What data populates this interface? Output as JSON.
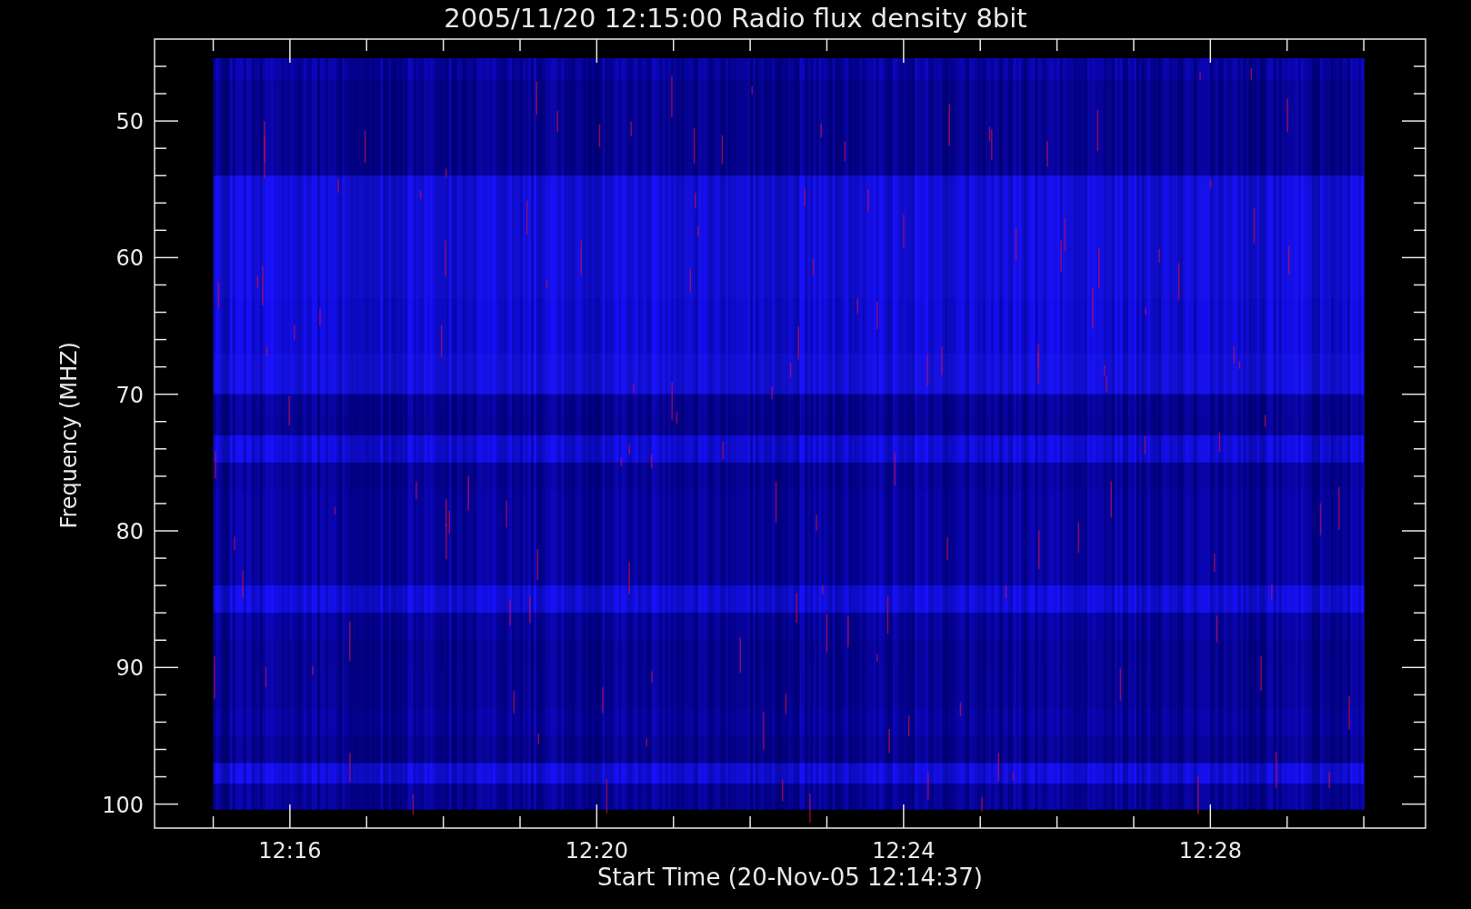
{
  "title": "2005/11/20 12:15:00 Radio flux density 8bit",
  "plot": {
    "ylabel": "Frequency (MHZ)",
    "xlabel": "Start Time (20-Nov-05 12:14:37)",
    "yticks": [
      "50",
      "60",
      "70",
      "80",
      "90",
      "100"
    ],
    "xticks": [
      "12:16",
      "12:20",
      "12:24",
      "12:28"
    ]
  }
}
